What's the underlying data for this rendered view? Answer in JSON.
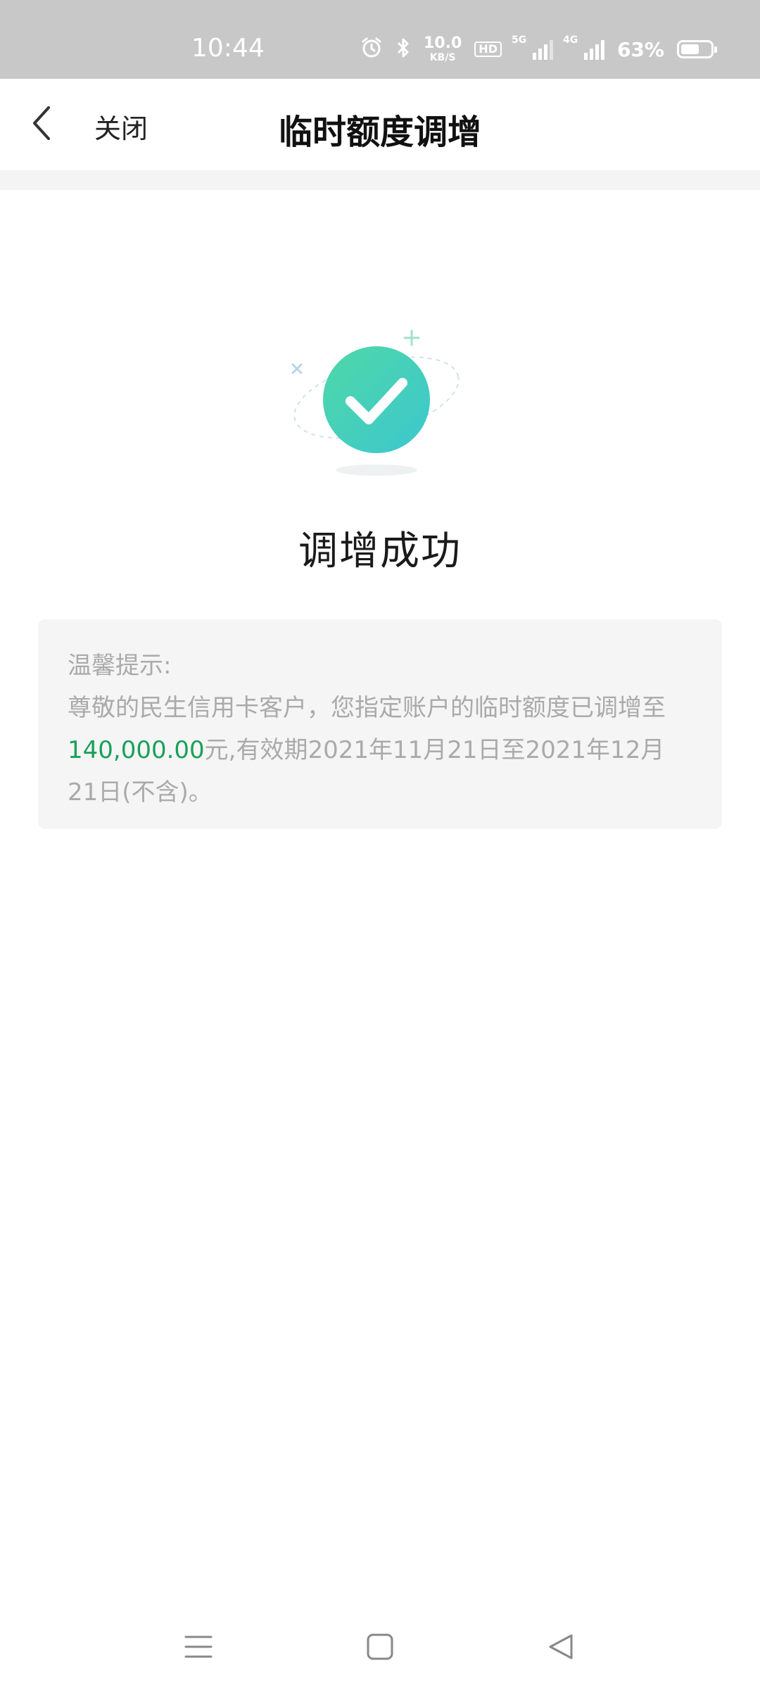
{
  "status_bar": {
    "time": "10:44",
    "net_speed_value": "10.0",
    "net_speed_unit": "KB/S",
    "hd_badge": "HD",
    "signal1_label": "5G",
    "signal2_label": "4G",
    "battery_percent": "63%",
    "battery_level": 0.63
  },
  "nav": {
    "back_icon": "chevron-left-icon",
    "close_label": "关闭",
    "title": "临时额度调增"
  },
  "result": {
    "icon": "success-check-icon",
    "title": "调增成功",
    "accent_color": "#3ecfb5"
  },
  "tip": {
    "heading": "温馨提示:",
    "text_before_amount": "尊敬的民生信用卡客户，您指定账户的临时额度已调增至",
    "amount": "140,000.00",
    "text_after_amount": "元,有效期2021年11月21日至2021年12月21日(不含)。",
    "amount_color": "#19a05a"
  },
  "system_nav": {
    "menu_icon": "menu-icon",
    "home_icon": "home-icon",
    "back_icon": "back-triangle-icon"
  }
}
